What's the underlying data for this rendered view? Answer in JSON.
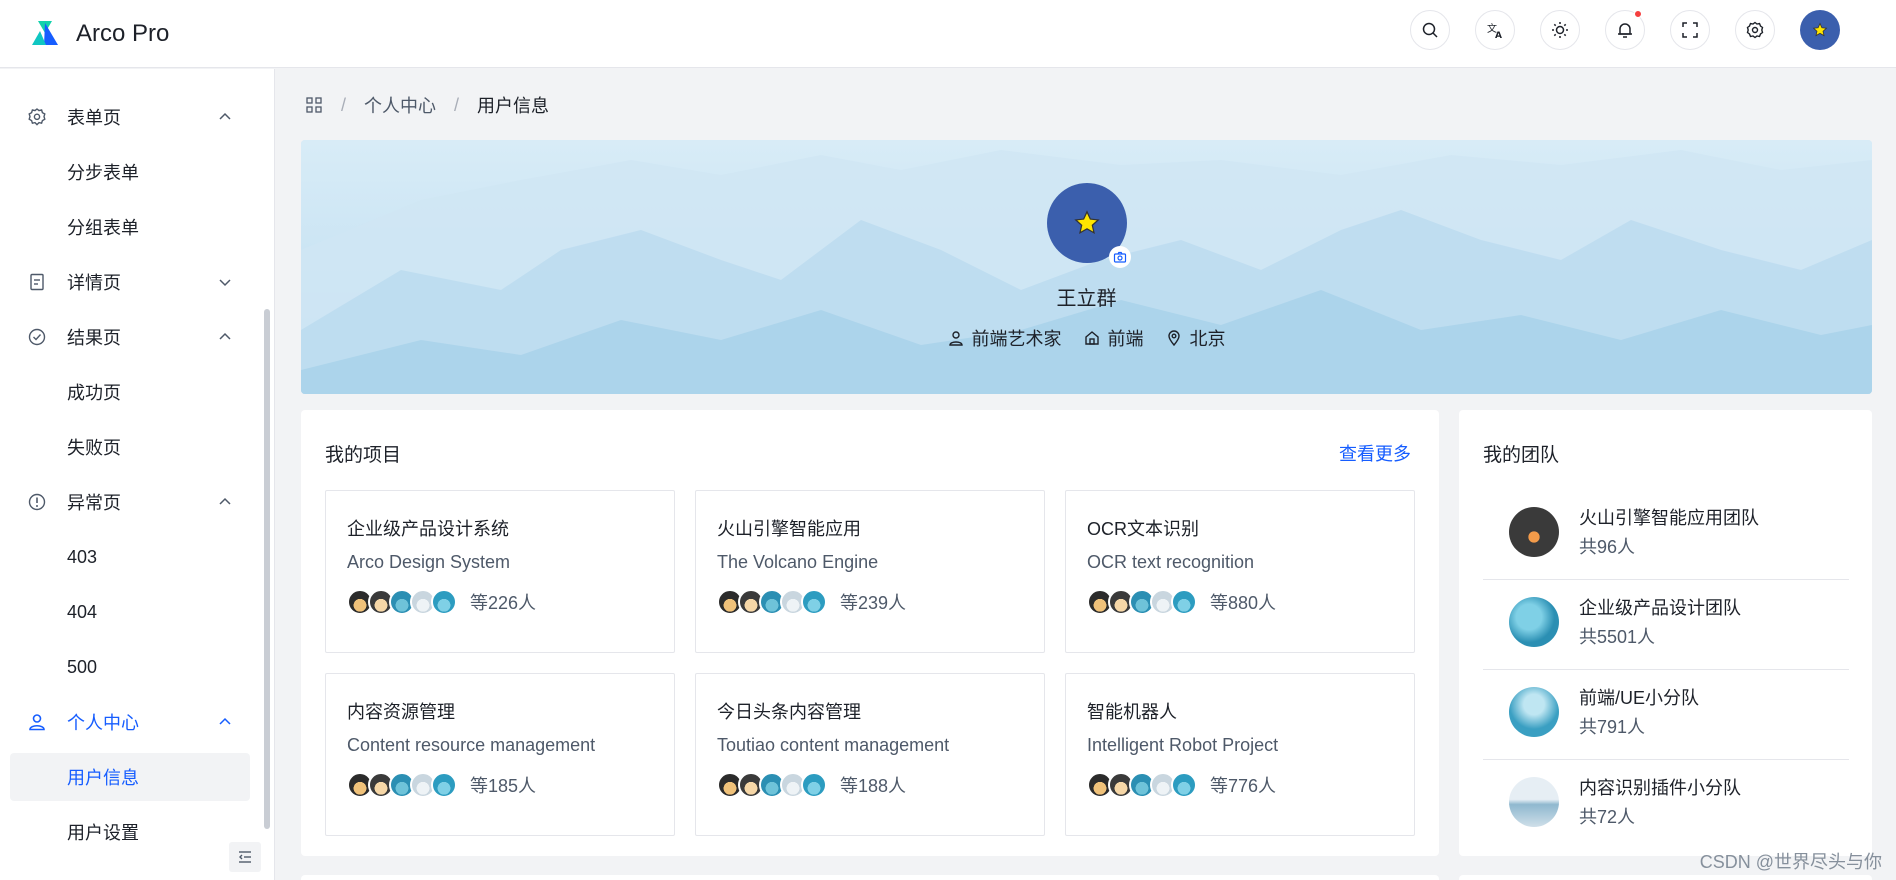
{
  "app": {
    "title": "Arco Pro"
  },
  "nav": {
    "actions": [
      {
        "name": "search-button",
        "icon": "search-icon"
      },
      {
        "name": "language-button",
        "icon": "translate-icon"
      },
      {
        "name": "theme-button",
        "icon": "sun-icon"
      },
      {
        "name": "notification-button",
        "icon": "bell-icon",
        "badge": true
      },
      {
        "name": "fullscreen-button",
        "icon": "fullscreen-icon"
      },
      {
        "name": "settings-button",
        "icon": "gear-icon"
      }
    ]
  },
  "sidebar": {
    "items": [
      {
        "label": "表单页",
        "icon": "form-icon",
        "type": "group",
        "expanded": true
      },
      {
        "label": "分步表单",
        "type": "sub"
      },
      {
        "label": "分组表单",
        "type": "sub"
      },
      {
        "label": "详情页",
        "icon": "file-icon",
        "type": "group",
        "expanded": false
      },
      {
        "label": "结果页",
        "icon": "check-circle-icon",
        "type": "group",
        "expanded": true
      },
      {
        "label": "成功页",
        "type": "sub"
      },
      {
        "label": "失败页",
        "type": "sub"
      },
      {
        "label": "异常页",
        "icon": "exclamation-circle-icon",
        "type": "group",
        "expanded": true
      },
      {
        "label": "403",
        "type": "sub"
      },
      {
        "label": "404",
        "type": "sub"
      },
      {
        "label": "500",
        "type": "sub"
      },
      {
        "label": "个人中心",
        "icon": "user-icon",
        "type": "group",
        "expanded": true,
        "active": true
      },
      {
        "label": "用户信息",
        "type": "sub",
        "selected": true
      },
      {
        "label": "用户设置",
        "type": "sub"
      }
    ]
  },
  "breadcrumb": {
    "items": [
      "个人中心",
      "用户信息"
    ]
  },
  "profile": {
    "name": "王立群",
    "job": "前端艺术家",
    "department": "前端",
    "location": "北京"
  },
  "projects": {
    "title": "我的项目",
    "view_more": "查看更多",
    "items": [
      {
        "name": "企业级产品设计系统",
        "desc": "Arco Design System",
        "count": "等226人"
      },
      {
        "name": "火山引擎智能应用",
        "desc": "The Volcano Engine",
        "count": "等239人"
      },
      {
        "name": "OCR文本识别",
        "desc": "OCR text recognition",
        "count": "等880人"
      },
      {
        "name": "内容资源管理",
        "desc": "Content resource management",
        "count": "等185人"
      },
      {
        "name": "今日头条内容管理",
        "desc": "Toutiao content management",
        "count": "等188人"
      },
      {
        "name": "智能机器人",
        "desc": "Intelligent Robot Project",
        "count": "等776人"
      }
    ]
  },
  "team": {
    "title": "我的团队",
    "items": [
      {
        "name": "火山引擎智能应用团队",
        "count": "共96人"
      },
      {
        "name": "企业级产品设计团队",
        "count": "共5501人"
      },
      {
        "name": "前端/UE小分队",
        "count": "共791人"
      },
      {
        "name": "内容识别插件小分队",
        "count": "共72人"
      }
    ]
  },
  "watermark": "CSDN @世界尽头与你",
  "colors": {
    "primary": "#165dff",
    "avatar_bg": "#3b5fad",
    "banner": "#cbe4f3"
  }
}
